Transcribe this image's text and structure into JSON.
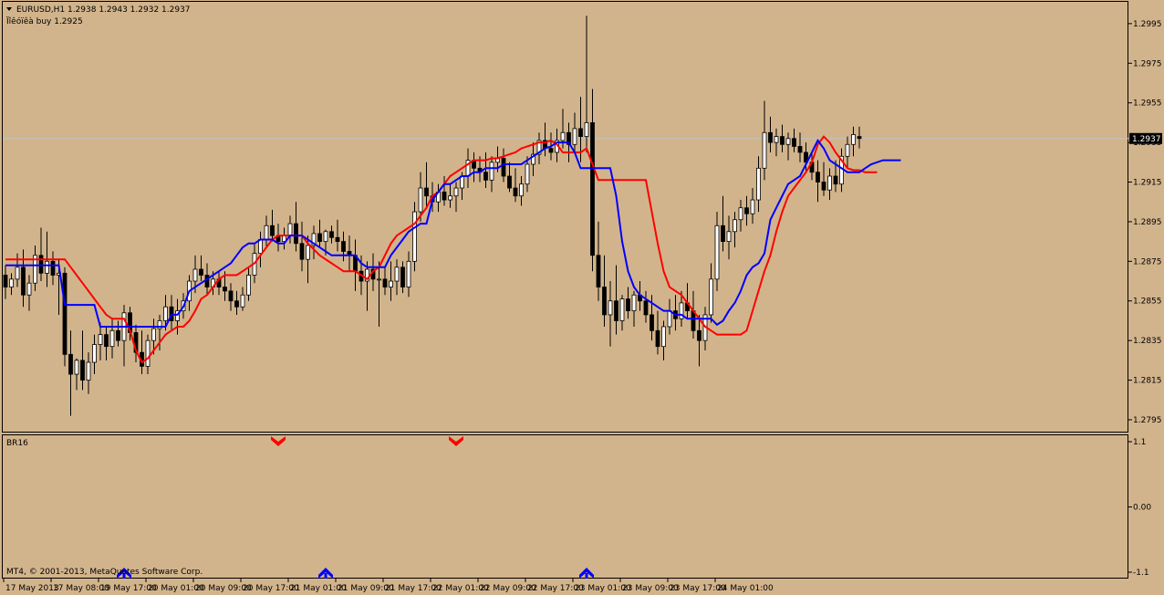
{
  "header": {
    "symbol_line": "EURUSD,H1  1.2938 1.2943 1.2932 1.2937",
    "indicator_line": "Ïîêóïêà buy 1.2925"
  },
  "indicator_panel": {
    "name": "BR16",
    "y_labels": [
      "1.1",
      "0.00",
      "-1.1"
    ]
  },
  "footer": {
    "copyright": "MT4, © 2001-2013, MetaQuotes Software Corp."
  },
  "colors": {
    "background": "#d2b48c",
    "bull_candle": "#ffffff",
    "bear_candle": "#000000",
    "blue_line": "#0000ff",
    "red_line": "#ff0000",
    "price_line": "#c0c0c0",
    "price_tag_bg": "#000000"
  },
  "chart_data": {
    "type": "candlestick",
    "symbol": "EURUSD",
    "timeframe": "H1",
    "ylim": [
      1.2789,
      1.3006
    ],
    "y_ticks": [
      1.2795,
      1.2815,
      1.2835,
      1.2855,
      1.2875,
      1.2895,
      1.2915,
      1.2935,
      1.2955,
      1.2975,
      1.2995
    ],
    "y_tick_labels": [
      "1.2795",
      "1.2815",
      "1.2835",
      "1.2855",
      "1.2875",
      "1.2895",
      "1.2915",
      "1.2935",
      "1.2955",
      "1.2975",
      "1.2995"
    ],
    "current_price": 1.2937,
    "current_price_label": "1.2937",
    "x_labels": [
      "17 May 2013",
      "17 May 08:00",
      "19 May 17:00",
      "20 May 01:00",
      "20 May 09:00",
      "20 May 17:00",
      "21 May 01:00",
      "21 May 09:00",
      "21 May 17:00",
      "22 May 01:00",
      "22 May 09:00",
      "22 May 17:00",
      "23 May 01:00",
      "23 May 09:00",
      "23 May 17:00",
      "24 May 01:00"
    ],
    "x_label_index": [
      0,
      8,
      16,
      24,
      32,
      40,
      48,
      56,
      64,
      72,
      80,
      88,
      96,
      104,
      112,
      120
    ],
    "candles_ohlc": [
      [
        1.2868,
        1.2873,
        1.2856,
        1.2862
      ],
      [
        1.2862,
        1.2869,
        1.2858,
        1.2866
      ],
      [
        1.2866,
        1.2879,
        1.2862,
        1.2872
      ],
      [
        1.2872,
        1.2881,
        1.2852,
        1.2858
      ],
      [
        1.2858,
        1.2868,
        1.285,
        1.2864
      ],
      [
        1.2864,
        1.2883,
        1.286,
        1.2878
      ],
      [
        1.2878,
        1.2892,
        1.2865,
        1.2869
      ],
      [
        1.2869,
        1.289,
        1.2862,
        1.2875
      ],
      [
        1.2875,
        1.288,
        1.2863,
        1.2868
      ],
      [
        1.2868,
        1.2876,
        1.2848,
        1.2869
      ],
      [
        1.2869,
        1.2872,
        1.2822,
        1.2828
      ],
      [
        1.2828,
        1.284,
        1.2797,
        1.2818
      ],
      [
        1.2818,
        1.2826,
        1.281,
        1.2825
      ],
      [
        1.2825,
        1.284,
        1.281,
        1.2815
      ],
      [
        1.2815,
        1.2829,
        1.2808,
        1.2824
      ],
      [
        1.2824,
        1.2838,
        1.2818,
        1.2833
      ],
      [
        1.2833,
        1.2844,
        1.2825,
        1.2838
      ],
      [
        1.2838,
        1.2842,
        1.2825,
        1.2832
      ],
      [
        1.2832,
        1.2846,
        1.2826,
        1.284
      ],
      [
        1.284,
        1.2845,
        1.2832,
        1.2835
      ],
      [
        1.2835,
        1.2853,
        1.2822,
        1.2849
      ],
      [
        1.2849,
        1.2852,
        1.2835,
        1.2839
      ],
      [
        1.2839,
        1.2843,
        1.2824,
        1.2829
      ],
      [
        1.2829,
        1.284,
        1.2818,
        1.2822
      ],
      [
        1.2822,
        1.2838,
        1.2818,
        1.2835
      ],
      [
        1.2835,
        1.2846,
        1.2828,
        1.2841
      ],
      [
        1.2841,
        1.2848,
        1.283,
        1.2845
      ],
      [
        1.2845,
        1.2858,
        1.284,
        1.2852
      ],
      [
        1.2852,
        1.2858,
        1.284,
        1.2845
      ],
      [
        1.2845,
        1.2856,
        1.2838,
        1.285
      ],
      [
        1.285,
        1.2859,
        1.2846,
        1.2855
      ],
      [
        1.2855,
        1.2868,
        1.285,
        1.2865
      ],
      [
        1.2865,
        1.2878,
        1.2859,
        1.2871
      ],
      [
        1.2871,
        1.2878,
        1.2865,
        1.2868
      ],
      [
        1.2868,
        1.2874,
        1.2858,
        1.2862
      ],
      [
        1.2862,
        1.287,
        1.2858,
        1.2866
      ],
      [
        1.2866,
        1.287,
        1.2858,
        1.2862
      ],
      [
        1.2862,
        1.287,
        1.2855,
        1.286
      ],
      [
        1.286,
        1.2864,
        1.285,
        1.2855
      ],
      [
        1.2855,
        1.286,
        1.2848,
        1.2852
      ],
      [
        1.2852,
        1.2862,
        1.285,
        1.2858
      ],
      [
        1.2858,
        1.2872,
        1.2855,
        1.2868
      ],
      [
        1.2868,
        1.2884,
        1.2864,
        1.2879
      ],
      [
        1.2879,
        1.289,
        1.2872,
        1.2886
      ],
      [
        1.2886,
        1.2898,
        1.2882,
        1.2893
      ],
      [
        1.2893,
        1.2901,
        1.2885,
        1.2888
      ],
      [
        1.2888,
        1.2894,
        1.288,
        1.2885
      ],
      [
        1.2885,
        1.2892,
        1.2881,
        1.2888
      ],
      [
        1.2888,
        1.2898,
        1.2884,
        1.2894
      ],
      [
        1.2894,
        1.2905,
        1.288,
        1.2884
      ],
      [
        1.2884,
        1.2895,
        1.287,
        1.2876
      ],
      [
        1.2876,
        1.2888,
        1.2864,
        1.2883
      ],
      [
        1.2883,
        1.2893,
        1.2876,
        1.2889
      ],
      [
        1.2889,
        1.2896,
        1.2882,
        1.2885
      ],
      [
        1.2885,
        1.2891,
        1.2878,
        1.289
      ],
      [
        1.289,
        1.2893,
        1.2884,
        1.2887
      ],
      [
        1.2887,
        1.2896,
        1.288,
        1.2885
      ],
      [
        1.2885,
        1.289,
        1.2875,
        1.288
      ],
      [
        1.288,
        1.2888,
        1.287,
        1.2878
      ],
      [
        1.2878,
        1.2886,
        1.286,
        1.287
      ],
      [
        1.287,
        1.2878,
        1.2858,
        1.2865
      ],
      [
        1.2865,
        1.2875,
        1.285,
        1.2871
      ],
      [
        1.2871,
        1.2879,
        1.286,
        1.2866
      ],
      [
        1.2866,
        1.2875,
        1.2842,
        1.2866
      ],
      [
        1.2866,
        1.2872,
        1.2858,
        1.2862
      ],
      [
        1.2862,
        1.2875,
        1.2855,
        1.2865
      ],
      [
        1.2865,
        1.2876,
        1.2858,
        1.2872
      ],
      [
        1.2872,
        1.2875,
        1.2859,
        1.2862
      ],
      [
        1.2862,
        1.288,
        1.2857,
        1.2875
      ],
      [
        1.2875,
        1.2905,
        1.287,
        1.29
      ],
      [
        1.29,
        1.292,
        1.2895,
        1.2912
      ],
      [
        1.2912,
        1.2925,
        1.2902,
        1.2908
      ],
      [
        1.2908,
        1.2915,
        1.29,
        1.2905
      ],
      [
        1.2905,
        1.2914,
        1.29,
        1.291
      ],
      [
        1.291,
        1.2918,
        1.2903,
        1.2906
      ],
      [
        1.2906,
        1.2914,
        1.2902,
        1.2908
      ],
      [
        1.2908,
        1.2915,
        1.29,
        1.2912
      ],
      [
        1.2912,
        1.292,
        1.2906,
        1.2918
      ],
      [
        1.2918,
        1.2932,
        1.2912,
        1.2926
      ],
      [
        1.2926,
        1.293,
        1.2915,
        1.2922
      ],
      [
        1.2922,
        1.2928,
        1.2915,
        1.292
      ],
      [
        1.292,
        1.293,
        1.2912,
        1.2916
      ],
      [
        1.2916,
        1.2928,
        1.291,
        1.2925
      ],
      [
        1.2925,
        1.2933,
        1.292,
        1.2927
      ],
      [
        1.2927,
        1.2932,
        1.2915,
        1.2918
      ],
      [
        1.2918,
        1.2925,
        1.291,
        1.2912
      ],
      [
        1.2912,
        1.2922,
        1.2905,
        1.2908
      ],
      [
        1.2908,
        1.2918,
        1.2903,
        1.2914
      ],
      [
        1.2914,
        1.2928,
        1.291,
        1.2924
      ],
      [
        1.2924,
        1.2935,
        1.2918,
        1.2929
      ],
      [
        1.2929,
        1.294,
        1.2924,
        1.2936
      ],
      [
        1.2936,
        1.2945,
        1.2928,
        1.2932
      ],
      [
        1.2932,
        1.294,
        1.2926,
        1.293
      ],
      [
        1.293,
        1.2942,
        1.2925,
        1.2936
      ],
      [
        1.2936,
        1.2952,
        1.2932,
        1.294
      ],
      [
        1.294,
        1.2945,
        1.2925,
        1.2934
      ],
      [
        1.2934,
        1.295,
        1.293,
        1.2942
      ],
      [
        1.2942,
        1.2958,
        1.2925,
        1.2938
      ],
      [
        1.2938,
        1.2999,
        1.293,
        1.2945
      ],
      [
        1.2945,
        1.2962,
        1.287,
        1.2878
      ],
      [
        1.2878,
        1.2895,
        1.2855,
        1.2862
      ],
      [
        1.2862,
        1.2878,
        1.2842,
        1.2848
      ],
      [
        1.2848,
        1.2865,
        1.2832,
        1.2855
      ],
      [
        1.2855,
        1.2873,
        1.2838,
        1.2845
      ],
      [
        1.2845,
        1.2858,
        1.284,
        1.2856
      ],
      [
        1.2856,
        1.2862,
        1.2846,
        1.285
      ],
      [
        1.285,
        1.286,
        1.2842,
        1.2858
      ],
      [
        1.2858,
        1.2865,
        1.285,
        1.2855
      ],
      [
        1.2855,
        1.286,
        1.2844,
        1.2848
      ],
      [
        1.2848,
        1.2858,
        1.2835,
        1.284
      ],
      [
        1.284,
        1.285,
        1.2828,
        1.2832
      ],
      [
        1.2832,
        1.2845,
        1.2825,
        1.2842
      ],
      [
        1.2842,
        1.2856,
        1.2838,
        1.285
      ],
      [
        1.285,
        1.2858,
        1.284,
        1.2846
      ],
      [
        1.2846,
        1.286,
        1.2842,
        1.2854
      ],
      [
        1.2854,
        1.2864,
        1.2846,
        1.285
      ],
      [
        1.285,
        1.286,
        1.2836,
        1.284
      ],
      [
        1.284,
        1.2848,
        1.2822,
        1.2835
      ],
      [
        1.2835,
        1.2852,
        1.283,
        1.2848
      ],
      [
        1.2848,
        1.2874,
        1.2844,
        1.2866
      ],
      [
        1.2866,
        1.29,
        1.286,
        1.2893
      ],
      [
        1.2893,
        1.2908,
        1.288,
        1.2885
      ],
      [
        1.2885,
        1.2898,
        1.2876,
        1.289
      ],
      [
        1.289,
        1.29,
        1.2882,
        1.2896
      ],
      [
        1.2896,
        1.2906,
        1.289,
        1.2902
      ],
      [
        1.2902,
        1.2908,
        1.2893,
        1.2899
      ],
      [
        1.2899,
        1.2912,
        1.2894,
        1.2906
      ],
      [
        1.2906,
        1.2928,
        1.29,
        1.2922
      ],
      [
        1.2922,
        1.2956,
        1.2916,
        1.294
      ],
      [
        1.294,
        1.2948,
        1.293,
        1.2935
      ],
      [
        1.2935,
        1.2942,
        1.2928,
        1.2938
      ],
      [
        1.2938,
        1.2944,
        1.293,
        1.2934
      ],
      [
        1.2934,
        1.294,
        1.2926,
        1.2937
      ],
      [
        1.2937,
        1.2942,
        1.293,
        1.2933
      ],
      [
        1.2933,
        1.294,
        1.2925,
        1.293
      ],
      [
        1.293,
        1.2935,
        1.292,
        1.2925
      ],
      [
        1.2925,
        1.293,
        1.2916,
        1.292
      ],
      [
        1.292,
        1.2926,
        1.2905,
        1.2915
      ],
      [
        1.2915,
        1.2925,
        1.2908,
        1.2911
      ],
      [
        1.2911,
        1.2922,
        1.2906,
        1.2918
      ],
      [
        1.2918,
        1.2926,
        1.291,
        1.2914
      ],
      [
        1.2914,
        1.2932,
        1.291,
        1.2928
      ],
      [
        1.2928,
        1.2938,
        1.2922,
        1.2934
      ],
      [
        1.2934,
        1.2943,
        1.2928,
        1.2939
      ],
      [
        1.2938,
        1.2943,
        1.2932,
        1.2937
      ]
    ],
    "blue_line": [
      1.2873,
      1.2873,
      1.2873,
      1.2873,
      1.2873,
      1.2873,
      1.2873,
      1.2873,
      1.2873,
      1.2873,
      1.2853,
      1.2853,
      1.2853,
      1.2853,
      1.2853,
      1.2853,
      1.2842,
      1.2842,
      1.2842,
      1.2842,
      1.2842,
      1.2842,
      1.2842,
      1.2842,
      1.2842,
      1.2842,
      1.2842,
      1.2842,
      1.2848,
      1.2848,
      1.2852,
      1.286,
      1.2862,
      1.2864,
      1.2866,
      1.2868,
      1.287,
      1.2872,
      1.2874,
      1.2878,
      1.2882,
      1.2884,
      1.2884,
      1.2886,
      1.2886,
      1.2886,
      1.2884,
      1.2884,
      1.2888,
      1.2888,
      1.2888,
      1.2886,
      1.2884,
      1.2882,
      1.288,
      1.2878,
      1.2878,
      1.2878,
      1.2878,
      1.2878,
      1.2874,
      1.2872,
      1.2872,
      1.2872,
      1.2872,
      1.2878,
      1.2882,
      1.2886,
      1.289,
      1.2892,
      1.2894,
      1.2894,
      1.2906,
      1.291,
      1.2914,
      1.2914,
      1.2916,
      1.2918,
      1.2918,
      1.292,
      1.292,
      1.2922,
      1.2922,
      1.2922,
      1.2924,
      1.2924,
      1.2924,
      1.2924,
      1.2926,
      1.2928,
      1.293,
      1.2932,
      1.2933,
      1.2935,
      1.2935,
      1.2935,
      1.293,
      1.2922,
      1.2922,
      1.2922,
      1.2922,
      1.2922,
      1.2922,
      1.2908,
      1.2885,
      1.287,
      1.2862,
      1.2858,
      1.2856,
      1.2854,
      1.2852,
      1.285,
      1.285,
      1.2848,
      1.2848,
      1.2846,
      1.2846,
      1.2846,
      1.2846,
      1.2846,
      1.2843,
      1.2845,
      1.285,
      1.2854,
      1.286,
      1.2868,
      1.2872,
      1.2874,
      1.2879,
      1.2896,
      1.2902,
      1.2908,
      1.2914,
      1.2916,
      1.2918,
      1.2924,
      1.293,
      1.2936,
      1.2932,
      1.2926,
      1.2924,
      1.2922,
      1.292,
      1.292,
      1.292,
      1.2922,
      1.2924,
      1.2925,
      1.2926,
      1.2926,
      1.2926,
      1.2926
    ],
    "red_line": [
      1.2876,
      1.2876,
      1.2876,
      1.2876,
      1.2876,
      1.2876,
      1.2876,
      1.2876,
      1.2876,
      1.2876,
      1.2876,
      1.2872,
      1.2868,
      1.2864,
      1.286,
      1.2856,
      1.2852,
      1.2848,
      1.2846,
      1.2846,
      1.2846,
      1.284,
      1.283,
      1.2824,
      1.2826,
      1.283,
      1.2834,
      1.2838,
      1.284,
      1.2842,
      1.2842,
      1.2845,
      1.285,
      1.2856,
      1.2858,
      1.2862,
      1.2866,
      1.2868,
      1.2868,
      1.2868,
      1.287,
      1.2872,
      1.2874,
      1.2878,
      1.2882,
      1.2886,
      1.2888,
      1.2888,
      1.2888,
      1.2888,
      1.2888,
      1.2884,
      1.2881,
      1.2878,
      1.2876,
      1.2874,
      1.2872,
      1.287,
      1.287,
      1.287,
      1.2868,
      1.2866,
      1.287,
      1.2872,
      1.2878,
      1.2884,
      1.2888,
      1.289,
      1.2892,
      1.2894,
      1.2898,
      1.2902,
      1.2908,
      1.291,
      1.2914,
      1.2918,
      1.292,
      1.2922,
      1.2924,
      1.2926,
      1.2926,
      1.2926,
      1.2927,
      1.2927,
      1.2928,
      1.2929,
      1.293,
      1.2932,
      1.2933,
      1.2934,
      1.2935,
      1.2935,
      1.2936,
      1.2934,
      1.293,
      1.293,
      1.293,
      1.293,
      1.2932,
      1.2924,
      1.2916,
      1.2916,
      1.2916,
      1.2916,
      1.2916,
      1.2916,
      1.2916,
      1.2916,
      1.2916,
      1.29,
      1.2884,
      1.287,
      1.2862,
      1.286,
      1.2858,
      1.2854,
      1.285,
      1.2846,
      1.2842,
      1.284,
      1.2838,
      1.2838,
      1.2838,
      1.2838,
      1.2838,
      1.284,
      1.285,
      1.286,
      1.287,
      1.2878,
      1.289,
      1.29,
      1.2908,
      1.2912,
      1.2916,
      1.292,
      1.2925,
      1.2934,
      1.2938,
      1.2935,
      1.293,
      1.2926,
      1.2922,
      1.2921,
      1.2921,
      1.292,
      1.292,
      1.292
    ],
    "indicator_range": [
      -1.1,
      1.1
    ],
    "down_arrows_index": [
      46,
      76
    ],
    "up_arrows_index": [
      20,
      54,
      98
    ]
  }
}
